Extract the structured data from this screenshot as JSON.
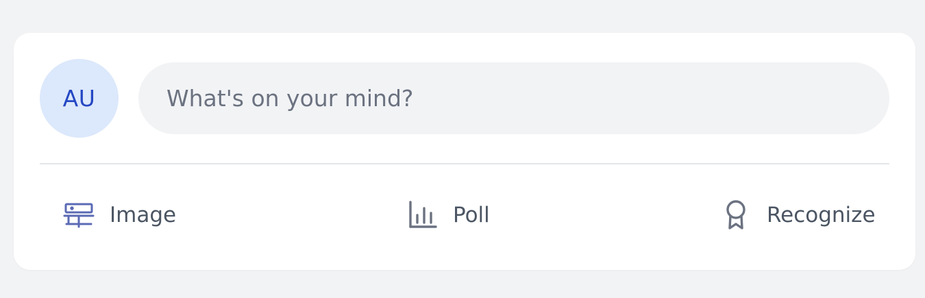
{
  "composer": {
    "avatar_initials": "AU",
    "placeholder": "What's on your mind?"
  },
  "actions": [
    {
      "label": "Image",
      "icon": "image-icon",
      "icon_color": "#5b6ab5"
    },
    {
      "label": "Poll",
      "icon": "bar-chart-icon",
      "icon_color": "#6b7280"
    },
    {
      "label": "Recognize",
      "icon": "award-ribbon-icon",
      "icon_color": "#6b7280"
    }
  ],
  "colors": {
    "page_background": "#f2f3f5",
    "card_background": "#ffffff",
    "avatar_background": "#dce8fb",
    "avatar_text": "#2447c4",
    "input_background": "#f2f3f5",
    "label_text": "#4b5563"
  }
}
